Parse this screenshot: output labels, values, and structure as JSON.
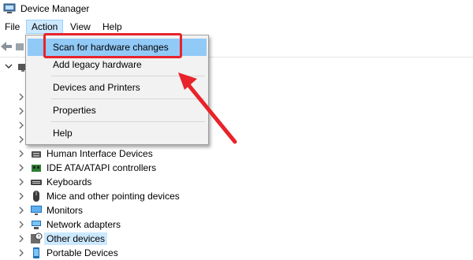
{
  "window": {
    "title": "Device Manager"
  },
  "menubar": {
    "items": [
      "File",
      "Action",
      "View",
      "Help"
    ]
  },
  "action_menu": {
    "items": [
      "Scan for hardware changes",
      "Add legacy hardware",
      "Devices and Printers",
      "Properties",
      "Help"
    ]
  },
  "devices": [
    "Human Interface Devices",
    "IDE ATA/ATAPI controllers",
    "Keyboards",
    "Mice and other pointing devices",
    "Monitors",
    "Network adapters",
    "Other devices",
    "Portable Devices"
  ],
  "colors": {
    "highlight": "#e8232a",
    "menu_hover": "#91c9f7",
    "selection": "#cce8ff"
  }
}
